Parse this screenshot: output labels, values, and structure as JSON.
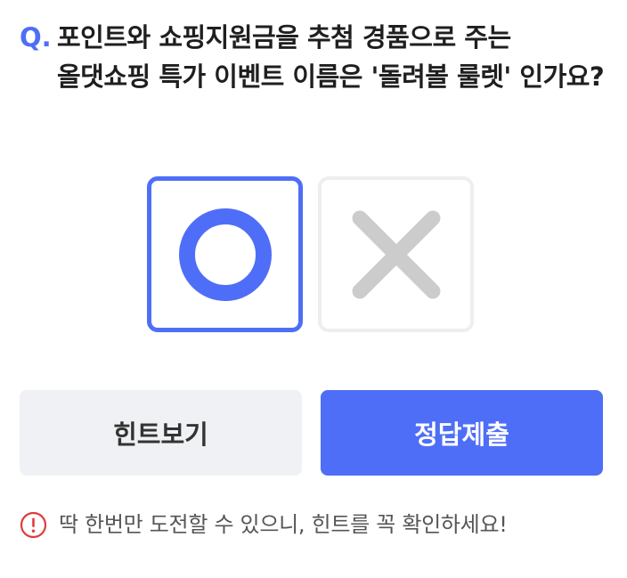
{
  "question": {
    "prefix": "Q.",
    "text": "포인트와 쇼핑지원금을 추첨 경품으로 주는 올댓쇼핑 특가 이벤트 이름은 '돌려볼 룰렛' 인가요?"
  },
  "choices": {
    "o": {
      "icon": "circle-o-icon",
      "selected": true
    },
    "x": {
      "icon": "x-mark-icon",
      "selected": false
    }
  },
  "buttons": {
    "hint_label": "힌트보기",
    "submit_label": "정답제출"
  },
  "notice": {
    "icon": "alert-circle-icon",
    "text": "딱 한번만 도전할 수 있으니, 힌트를 꼭 확인하세요!"
  },
  "colors": {
    "accent": "#4f6ef7",
    "alert": "#e03c3c",
    "x_mark": "#cccccc",
    "hint_bg": "#f0f1f4"
  }
}
